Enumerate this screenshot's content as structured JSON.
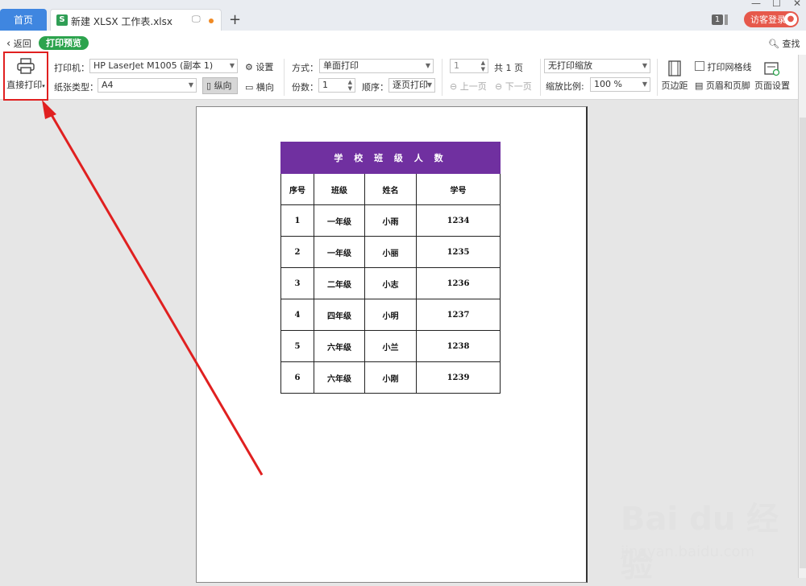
{
  "tabs": {
    "home": "首页",
    "file": "新建 XLSX 工作表.xlsx",
    "add": "+"
  },
  "header": {
    "count_badge": "1",
    "login": "访客登录"
  },
  "nav": {
    "back": "返回",
    "mode": "打印预览",
    "find": "查找"
  },
  "ribbon": {
    "direct_print": "直接打印",
    "printer_label": "打印机：",
    "printer_value": "HP LaserJet M1005 (副本 1)",
    "settings": "设置",
    "paper_label": "纸张类型：",
    "paper_value": "A4",
    "portrait": "纵向",
    "landscape": "横向",
    "method_label": "方式：",
    "method_value": "单面打印",
    "copies_label": "份数：",
    "copies_value": "1",
    "order_label": "顺序：",
    "order_value": "逐页打印",
    "page_value": "1",
    "total_pages": "共 1 页",
    "prev_page": "上一页",
    "next_page": "下一页",
    "scale_value": "无打印缩放",
    "ratio_label": "缩放比例:",
    "ratio_value": "100 %",
    "margins": "页边距",
    "gridlines": "打印网格线",
    "header_footer": "页眉和页脚",
    "page_setup": "页面设置"
  },
  "sheet": {
    "title": "学 校 班 级 人 数",
    "columns": [
      "序号",
      "班级",
      "姓名",
      "学号"
    ],
    "rows": [
      [
        "1",
        "一年级",
        "小雨",
        "1234"
      ],
      [
        "2",
        "一年级",
        "小丽",
        "1235"
      ],
      [
        "3",
        "二年级",
        "小志",
        "1236"
      ],
      [
        "4",
        "四年级",
        "小明",
        "1237"
      ],
      [
        "5",
        "六年级",
        "小兰",
        "1238"
      ],
      [
        "6",
        "六年级",
        "小刚",
        "1239"
      ]
    ]
  },
  "watermark": {
    "brand": "Bai du 经验",
    "url": "jingyan.baidu.com"
  },
  "colors": {
    "accent_green": "#2ca34d",
    "tab_blue": "#3f86e0",
    "header_purple": "#7030a0",
    "annotation_red": "#e02020"
  }
}
